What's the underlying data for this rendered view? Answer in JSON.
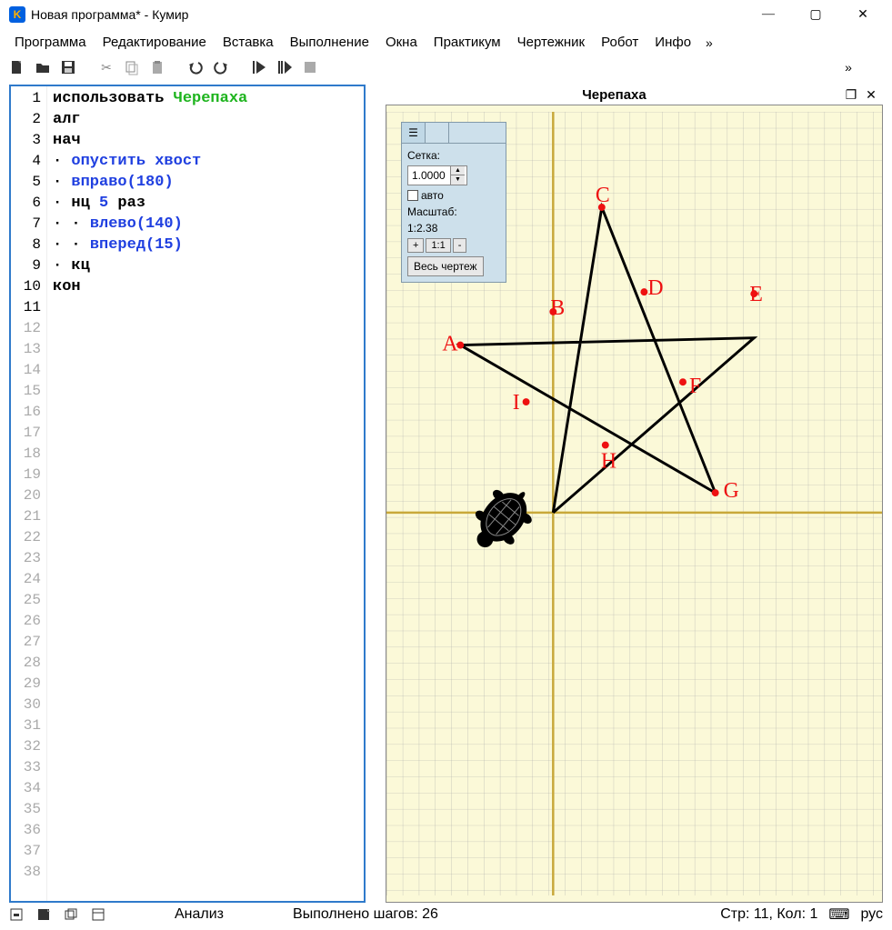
{
  "title": "Новая программа* - Кумир",
  "menu": [
    "Программа",
    "Редактирование",
    "Вставка",
    "Выполнение",
    "Окна",
    "Практикум",
    "Чертежник",
    "Робот",
    "Инфо"
  ],
  "menu_more": "»",
  "toolbar_more": "»",
  "code": {
    "lines": [
      {
        "n": 1,
        "tokens": [
          [
            "kw-use",
            "использовать "
          ],
          [
            "kw-mod",
            "Черепаха"
          ]
        ]
      },
      {
        "n": 2,
        "tokens": [
          [
            "kw-blk",
            "алг"
          ]
        ]
      },
      {
        "n": 3,
        "tokens": [
          [
            "kw-blk",
            "нач"
          ]
        ]
      },
      {
        "n": 4,
        "tokens": [
          [
            "dot",
            "· "
          ],
          [
            "kw-cmd",
            "опустить хвост"
          ]
        ]
      },
      {
        "n": 5,
        "tokens": [
          [
            "dot",
            "· "
          ],
          [
            "kw-cmd",
            "вправо"
          ],
          [
            "paren",
            "("
          ],
          [
            "num",
            "180"
          ],
          [
            "paren",
            ")"
          ]
        ]
      },
      {
        "n": 6,
        "tokens": [
          [
            "dot",
            "· "
          ],
          [
            "kw-blk",
            "нц "
          ],
          [
            "num",
            "5"
          ],
          [
            "kw-blk",
            " раз"
          ]
        ]
      },
      {
        "n": 7,
        "tokens": [
          [
            "dot",
            "· · "
          ],
          [
            "kw-cmd",
            "влево"
          ],
          [
            "paren",
            "("
          ],
          [
            "num",
            "140"
          ],
          [
            "paren",
            ")"
          ]
        ]
      },
      {
        "n": 8,
        "tokens": [
          [
            "dot",
            "· · "
          ],
          [
            "kw-cmd",
            "вперед"
          ],
          [
            "paren",
            "("
          ],
          [
            "num",
            "15"
          ],
          [
            "paren",
            ")"
          ]
        ]
      },
      {
        "n": 9,
        "tokens": [
          [
            "dot",
            "· "
          ],
          [
            "kw-blk",
            "кц"
          ]
        ]
      },
      {
        "n": 10,
        "tokens": [
          [
            "kw-blk",
            "кон"
          ]
        ]
      },
      {
        "n": 11,
        "tokens": []
      }
    ],
    "total_rows": 38
  },
  "turtle": {
    "title": "Черепаха",
    "panel": {
      "grid_label": "Сетка:",
      "grid_value": "1.0000",
      "auto_label": "авто",
      "scale_label": "Масштаб:",
      "scale_value": "1:2.38",
      "btn_plus": "+",
      "btn_11": "1:1",
      "btn_minus": "-",
      "btn_all": "Весь чертеж"
    },
    "labels": [
      "A",
      "B",
      "C",
      "D",
      "E",
      "F",
      "G",
      "H",
      "I"
    ]
  },
  "status": {
    "analysis": "Анализ",
    "steps": "Выполнено шагов: 26",
    "cursor": "Стр: 11, Кол: 1",
    "lang": "рус"
  }
}
